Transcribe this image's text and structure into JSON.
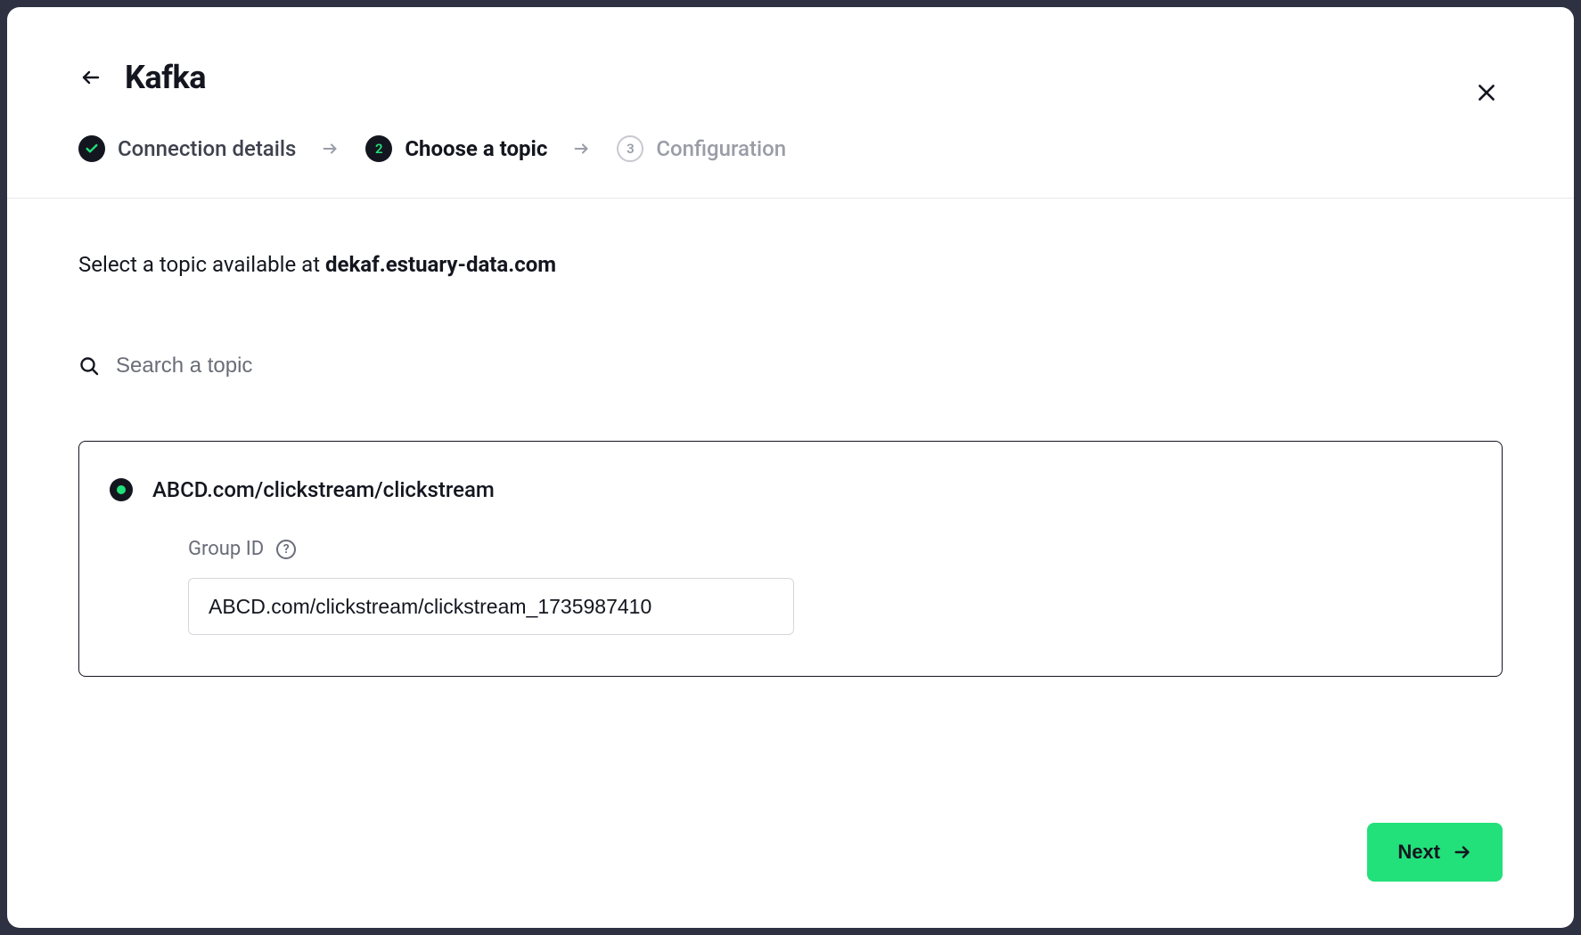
{
  "header": {
    "title": "Kafka"
  },
  "stepper": {
    "step1": {
      "label": "Connection details"
    },
    "step2": {
      "number": "2",
      "label": "Choose a topic"
    },
    "step3": {
      "number": "3",
      "label": "Configuration"
    }
  },
  "content": {
    "instruction_prefix": "Select a topic available at ",
    "instruction_host": "dekaf.estuary-data.com",
    "search_placeholder": "Search a topic",
    "topic": {
      "name": "ABCD.com/clickstream/clickstream",
      "group_id_label": "Group ID",
      "group_id_value": "ABCD.com/clickstream/clickstream_1735987410"
    }
  },
  "footer": {
    "next_label": "Next"
  }
}
